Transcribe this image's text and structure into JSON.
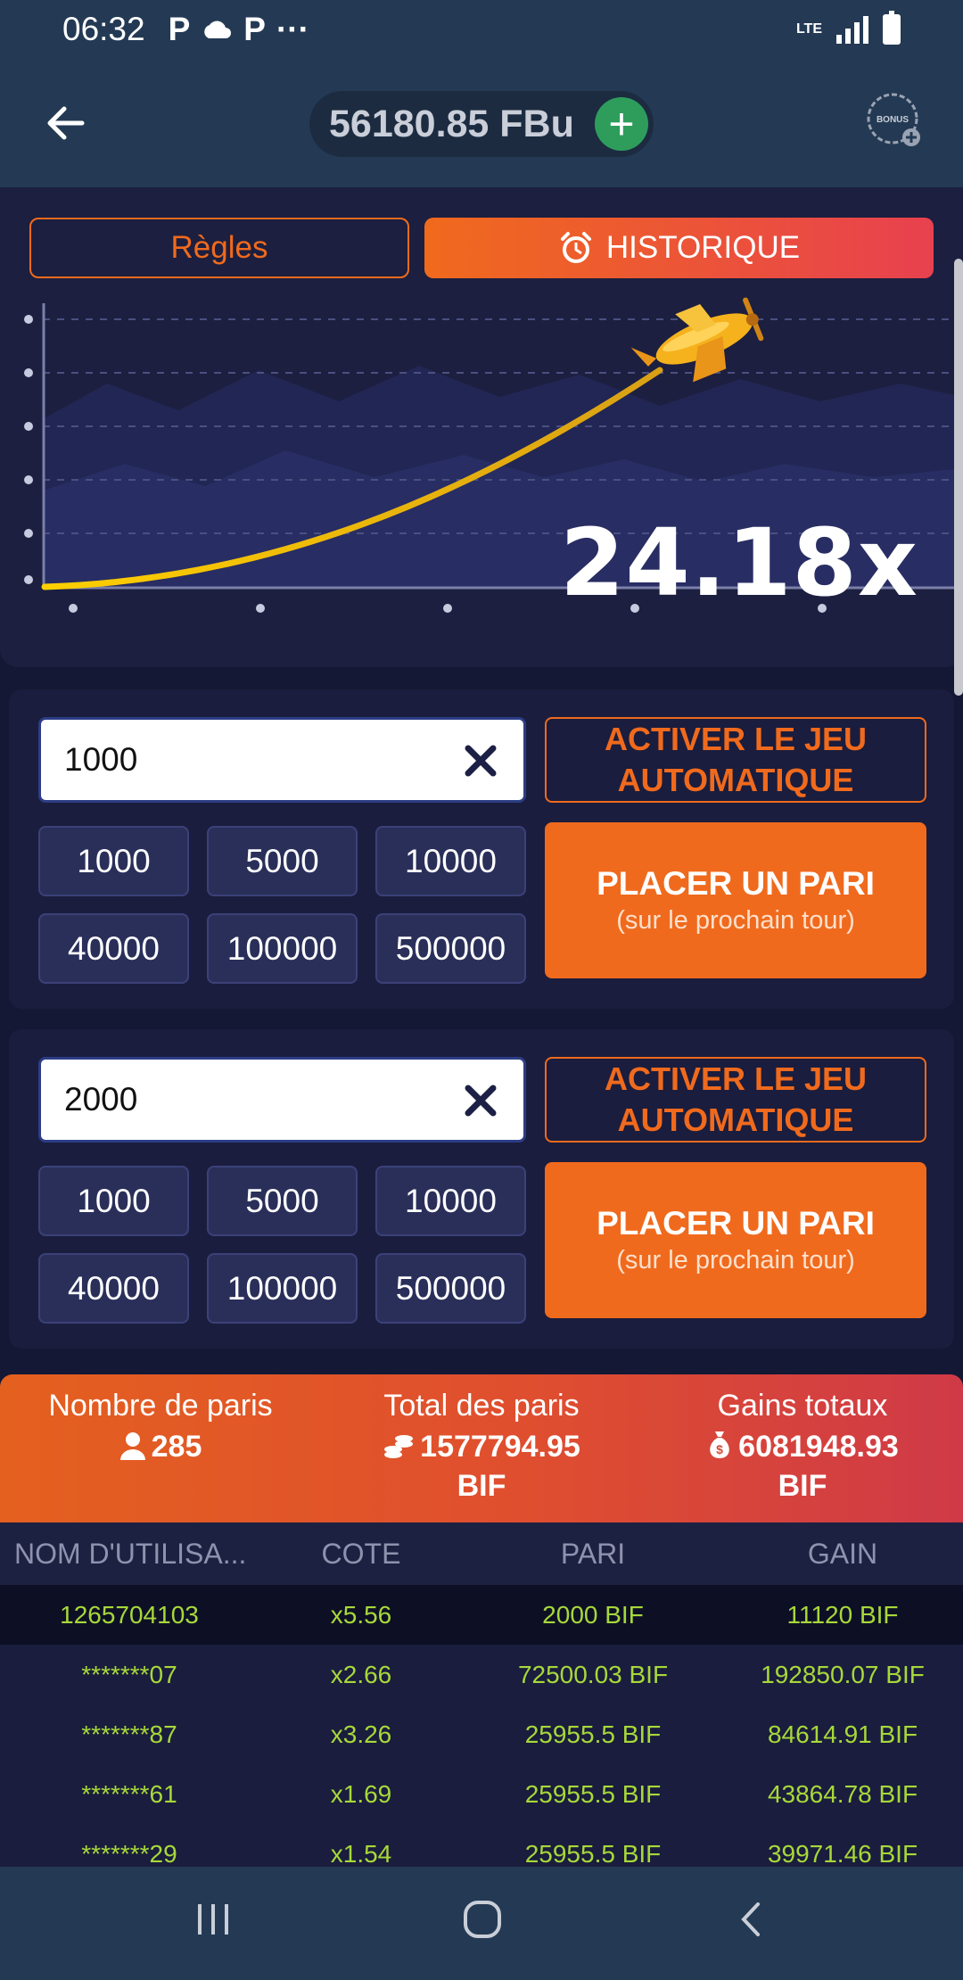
{
  "status": {
    "time": "06:32",
    "network": "LTE",
    "icons": [
      "p-icon",
      "cloud-icon",
      "p-icon",
      "more-icon"
    ]
  },
  "header": {
    "balance": "56180.85 FBu",
    "bonus_label": "BONUS"
  },
  "tabs": {
    "rules": "Règles",
    "history": "HISTORIQUE"
  },
  "game": {
    "multiplier": "24.18x"
  },
  "bets": [
    {
      "value": "1000",
      "auto_label": "ACTIVER LE JEU AUTOMATIQUE",
      "amounts": [
        "1000",
        "5000",
        "10000",
        "40000",
        "100000",
        "500000"
      ],
      "place_label": "PLACER UN PARI",
      "place_sub": "(sur le prochain tour)"
    },
    {
      "value": "2000",
      "auto_label": "ACTIVER LE JEU AUTOMATIQUE",
      "amounts": [
        "1000",
        "5000",
        "10000",
        "40000",
        "100000",
        "500000"
      ],
      "place_label": "PLACER UN PARI",
      "place_sub": "(sur le prochain tour)"
    }
  ],
  "stats": {
    "bets_count_label": "Nombre de paris",
    "bets_count": "285",
    "total_label": "Total des paris",
    "total_value": "1577794.95",
    "total_unit": "BIF",
    "wins_label": "Gains totaux",
    "wins_value": "6081948.93",
    "wins_unit": "BIF"
  },
  "table": {
    "headers": [
      "NOM D'UTILISA...",
      "COTE",
      "PARI",
      "GAIN"
    ],
    "rows": [
      [
        "1265704103",
        "x5.56",
        "2000 BIF",
        "11120 BIF"
      ],
      [
        "*******07",
        "x2.66",
        "72500.03 BIF",
        "192850.07 BIF"
      ],
      [
        "*******87",
        "x3.26",
        "25955.5 BIF",
        "84614.91 BIF"
      ],
      [
        "*******61",
        "x1.69",
        "25955.5 BIF",
        "43864.78 BIF"
      ],
      [
        "*******29",
        "x1.54",
        "25955.5 BIF",
        "39971.46 BIF"
      ]
    ]
  },
  "colors": {
    "accent": "#f06a1d",
    "win_text": "#a7d83a",
    "panel": "#1a1d3d"
  }
}
